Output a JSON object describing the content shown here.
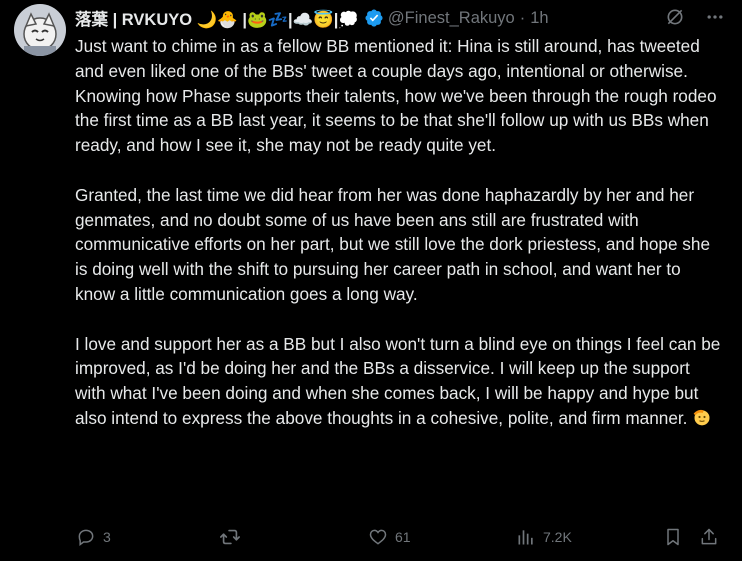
{
  "tweet": {
    "display_name": "落葉 | RVKUYO 🌙🐣 |🐸💤|☁️😇|💭",
    "handle": "@Finest_Rakuyo",
    "separator": "·",
    "time": "1h",
    "paragraphs": [
      "Just want to chime in as a fellow BB mentioned it: Hina is still around, has tweeted and even liked one of the BBs' tweet a couple days ago, intentional or otherwise.  Knowing how Phase supports their talents, how we've been through the rough rodeo the first time as a BB last year, it seems to be that she'll follow up with us BBs when ready, and how I see it, she may not be ready quite yet.",
      "Granted, the last time we did hear from her was done haphazardly by her and her genmates, and no doubt some of us have been ans still are frustrated with communicative efforts on her part, but we still love the dork priestess, and hope she is doing well with the shift to pursuing her career path in school, and want her to know a little communication goes a long way.",
      "I love and support her as a BB but I also won't turn a blind eye on things I feel can be improved, as I'd be doing her and the BBs a disservice. I will keep up the support with what I've been doing and when she comes back, I will be happy and hype but also intend to express the above thoughts in a cohesive, polite, and firm manner."
    ],
    "trailing_emoji_icon": "saluting-face-icon"
  },
  "actions": {
    "replies": "3",
    "reposts": "",
    "likes": "61",
    "views": "7.2K"
  },
  "icons": {
    "verified": "verified-badge-icon",
    "grok": "grok-icon",
    "more": "more-icon",
    "reply": "reply-icon",
    "repost": "repost-icon",
    "like": "heart-icon",
    "views": "views-icon",
    "bookmark": "bookmark-icon",
    "share": "share-icon"
  },
  "colors": {
    "background": "#000000",
    "text": "#e7e9ea",
    "secondary": "#71767b",
    "verified": "#1d9bf0"
  }
}
